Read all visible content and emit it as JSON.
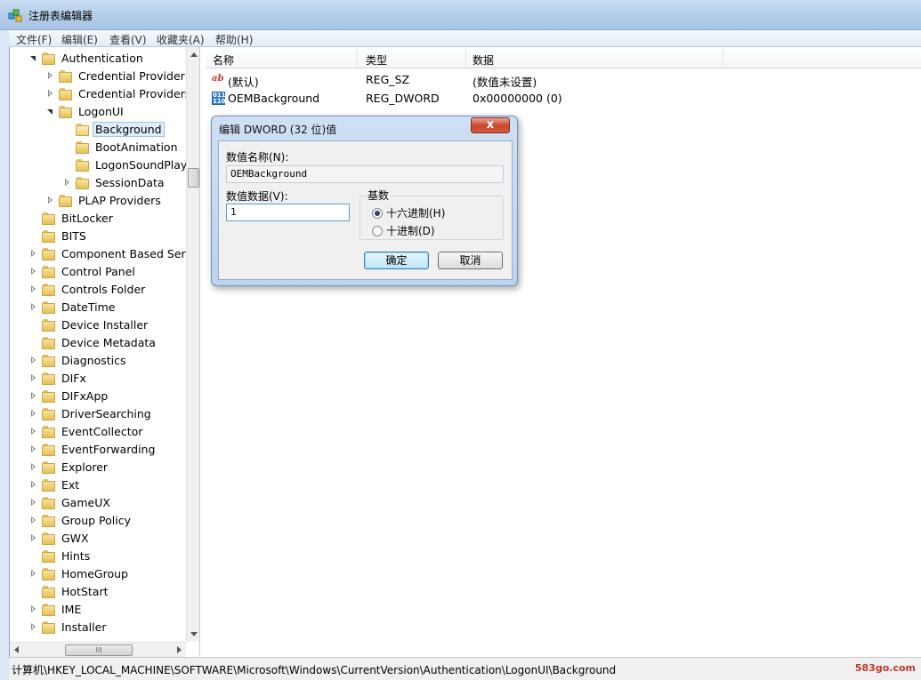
{
  "window": {
    "title": "注册表编辑器"
  },
  "menu": [
    "文件(F)",
    "编辑(E)",
    "查看(V)",
    "收藏夹(A)",
    "帮助(H)"
  ],
  "tree": [
    {
      "label": "Authentication",
      "indent": 1,
      "state": "expanded"
    },
    {
      "label": "Credential Provider F",
      "indent": 2,
      "state": "collapsed"
    },
    {
      "label": "Credential Providers",
      "indent": 2,
      "state": "collapsed"
    },
    {
      "label": "LogonUI",
      "indent": 2,
      "state": "expanded"
    },
    {
      "label": "Background",
      "indent": 3,
      "state": "leaf",
      "selected": true
    },
    {
      "label": "BootAnimation",
      "indent": 3,
      "state": "leaf"
    },
    {
      "label": "LogonSoundPlaye",
      "indent": 3,
      "state": "leaf"
    },
    {
      "label": "SessionData",
      "indent": 3,
      "state": "collapsed"
    },
    {
      "label": "PLAP Providers",
      "indent": 2,
      "state": "collapsed"
    },
    {
      "label": "BitLocker",
      "indent": 1,
      "state": "leaf"
    },
    {
      "label": "BITS",
      "indent": 1,
      "state": "leaf"
    },
    {
      "label": "Component Based Servic",
      "indent": 1,
      "state": "collapsed"
    },
    {
      "label": "Control Panel",
      "indent": 1,
      "state": "collapsed"
    },
    {
      "label": "Controls Folder",
      "indent": 1,
      "state": "collapsed"
    },
    {
      "label": "DateTime",
      "indent": 1,
      "state": "collapsed"
    },
    {
      "label": "Device Installer",
      "indent": 1,
      "state": "leaf"
    },
    {
      "label": "Device Metadata",
      "indent": 1,
      "state": "leaf"
    },
    {
      "label": "Diagnostics",
      "indent": 1,
      "state": "collapsed"
    },
    {
      "label": "DIFx",
      "indent": 1,
      "state": "collapsed"
    },
    {
      "label": "DIFxApp",
      "indent": 1,
      "state": "collapsed"
    },
    {
      "label": "DriverSearching",
      "indent": 1,
      "state": "collapsed"
    },
    {
      "label": "EventCollector",
      "indent": 1,
      "state": "collapsed"
    },
    {
      "label": "EventForwarding",
      "indent": 1,
      "state": "collapsed"
    },
    {
      "label": "Explorer",
      "indent": 1,
      "state": "collapsed"
    },
    {
      "label": "Ext",
      "indent": 1,
      "state": "collapsed"
    },
    {
      "label": "GameUX",
      "indent": 1,
      "state": "collapsed"
    },
    {
      "label": "Group Policy",
      "indent": 1,
      "state": "collapsed"
    },
    {
      "label": "GWX",
      "indent": 1,
      "state": "collapsed"
    },
    {
      "label": "Hints",
      "indent": 1,
      "state": "leaf"
    },
    {
      "label": "HomeGroup",
      "indent": 1,
      "state": "collapsed"
    },
    {
      "label": "HotStart",
      "indent": 1,
      "state": "leaf"
    },
    {
      "label": "IME",
      "indent": 1,
      "state": "collapsed"
    },
    {
      "label": "Installer",
      "indent": 1,
      "state": "collapsed"
    }
  ],
  "list": {
    "columns": [
      "名称",
      "类型",
      "数据"
    ],
    "rows": [
      {
        "icon": "string-value-icon",
        "name": "(默认)",
        "type": "REG_SZ",
        "data": "(数值未设置)"
      },
      {
        "icon": "dword-value-icon",
        "name": "OEMBackground",
        "type": "REG_DWORD",
        "data": "0x00000000 (0)"
      }
    ]
  },
  "dialog": {
    "title": "编辑 DWORD (32 位)值",
    "value_name_label": "数值名称(N):",
    "value_name": "OEMBackground",
    "value_data_label": "数值数据(V):",
    "value_data": "1",
    "base_label": "基数",
    "hex_label": "十六进制(H)",
    "dec_label": "十进制(D)",
    "hex_selected": true,
    "ok_label": "确定",
    "cancel_label": "取消",
    "close_label": "x"
  },
  "status": {
    "path": "计算机\\HKEY_LOCAL_MACHINE\\SOFTWARE\\Microsoft\\Windows\\CurrentVersion\\Authentication\\LogonUI\\Background"
  },
  "watermark": "583go.com",
  "hscroll_thumb_label": "III"
}
